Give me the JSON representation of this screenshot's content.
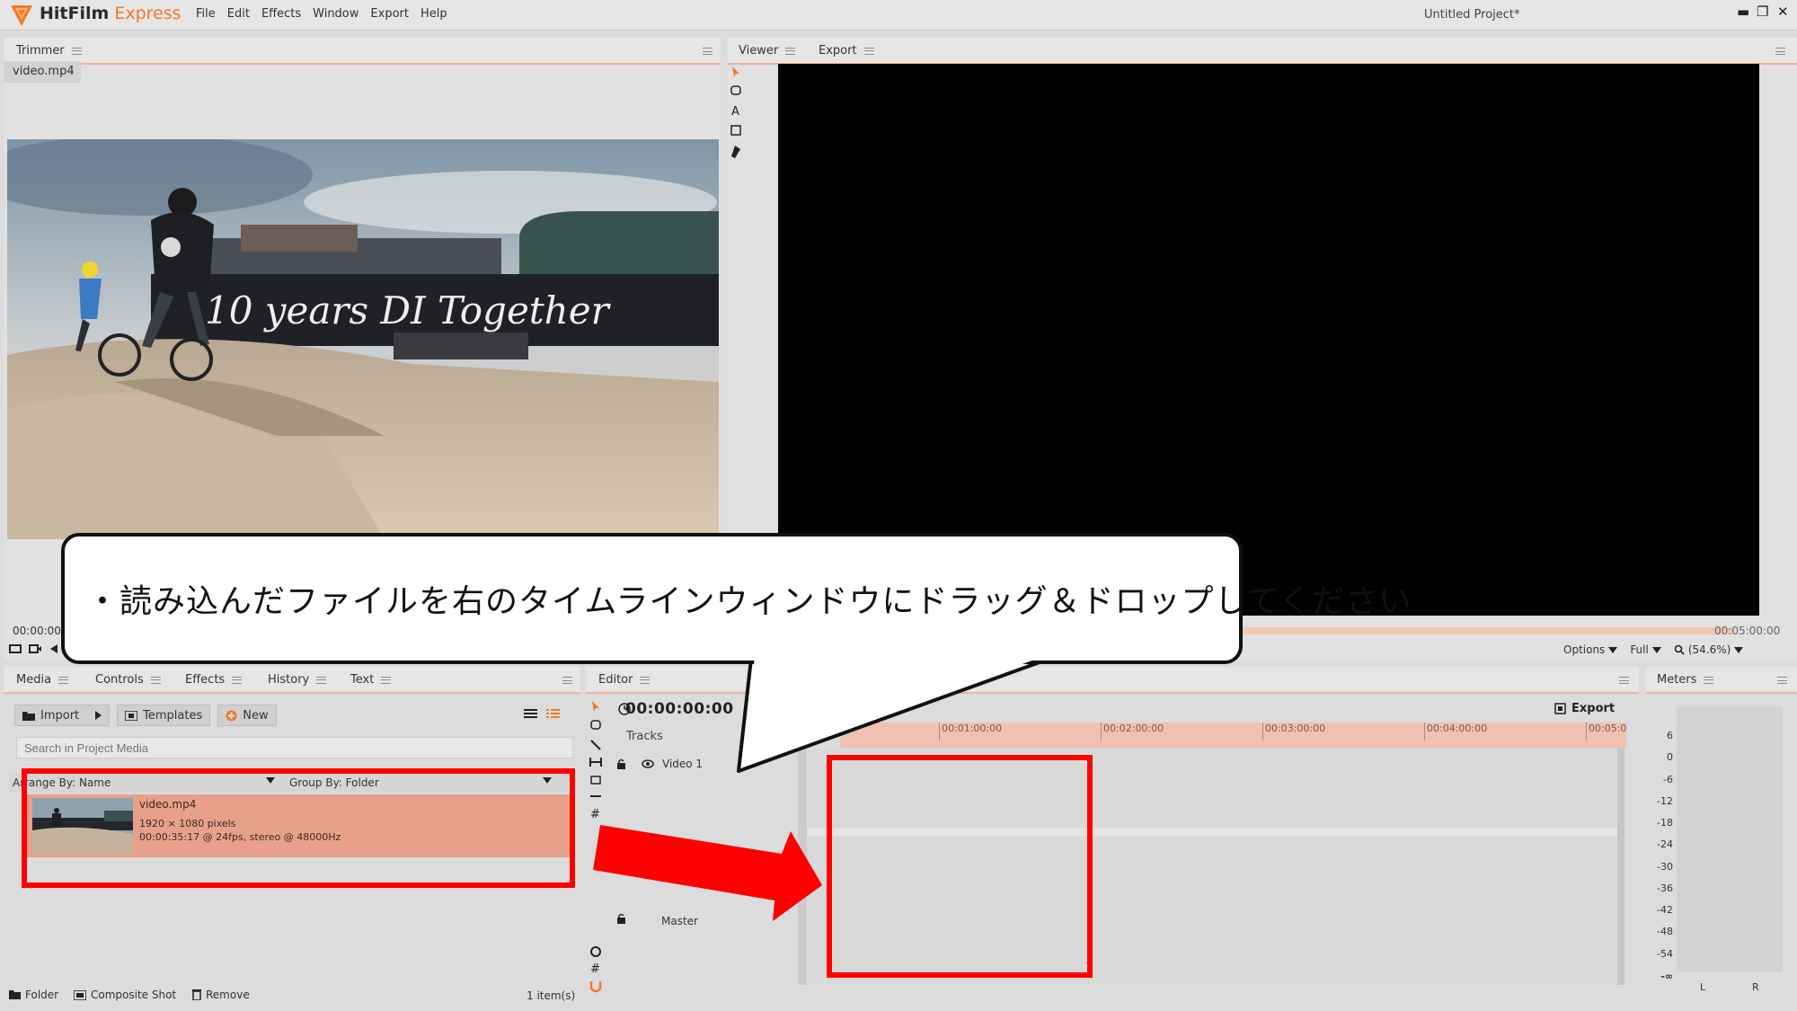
{
  "app": {
    "brand": "HitFilm",
    "brand_suffix": " Express",
    "project_title": "Untitled Project*",
    "window_min": "▬",
    "window_max": "❐",
    "window_close": "✕"
  },
  "menu": {
    "items": [
      "File",
      "Edit",
      "Effects",
      "Window",
      "Export",
      "Help"
    ]
  },
  "trimmer": {
    "tab": "Trimmer",
    "file_tab": "video.mp4",
    "time": "00:00:00"
  },
  "viewer": {
    "tabs": [
      "Viewer",
      "Export"
    ],
    "end_time": "00:05:00:00",
    "options_label": "Options",
    "quality_label": "Full",
    "zoom_label": "(54.6%)"
  },
  "media_panel": {
    "tabs": [
      "Media",
      "Controls",
      "Effects",
      "History",
      "Text"
    ],
    "import_label": "Import",
    "templates_label": "Templates",
    "new_label": "New",
    "search_placeholder": "Search in Project Media",
    "arrange_label": "Arrange By: Name",
    "group_label": "Group By: Folder",
    "item": {
      "name": "video.mp4",
      "resolution": "1920 × 1080 pixels",
      "details": "00:00:35:17 @ 24fps, stereo @ 48000Hz"
    },
    "footer": {
      "folder_label": "Folder",
      "composite_label": "Composite Shot",
      "remove_label": "Remove",
      "count": "1 item(s)"
    }
  },
  "editor": {
    "tab": "Editor",
    "timecode": "00:00:00:00",
    "tracks_label": "Tracks",
    "video_track": "Video 1",
    "master_track": "Master",
    "export_label": "Export",
    "ruler_ticks": [
      "00:01:00:00",
      "00:02:00:00",
      "00:03:00:00",
      "00:04:00:00",
      "00:05:0"
    ]
  },
  "meters": {
    "tab": "Meters",
    "scale": [
      "6",
      "0",
      "-6",
      "-12",
      "-18",
      "-24",
      "-30",
      "-36",
      "-42",
      "-48",
      "-54",
      "-∞"
    ],
    "left": "L",
    "right": "R"
  },
  "annotation": {
    "instruction": "・読み込んだファイルを右のタイムラインウィンドウにドラッグ＆ドロップしてください"
  },
  "colors": {
    "accent": "#f07a2a",
    "selection": "#e8a08a",
    "ruler": "#f0c1b3",
    "highlight": "#ff0000"
  }
}
